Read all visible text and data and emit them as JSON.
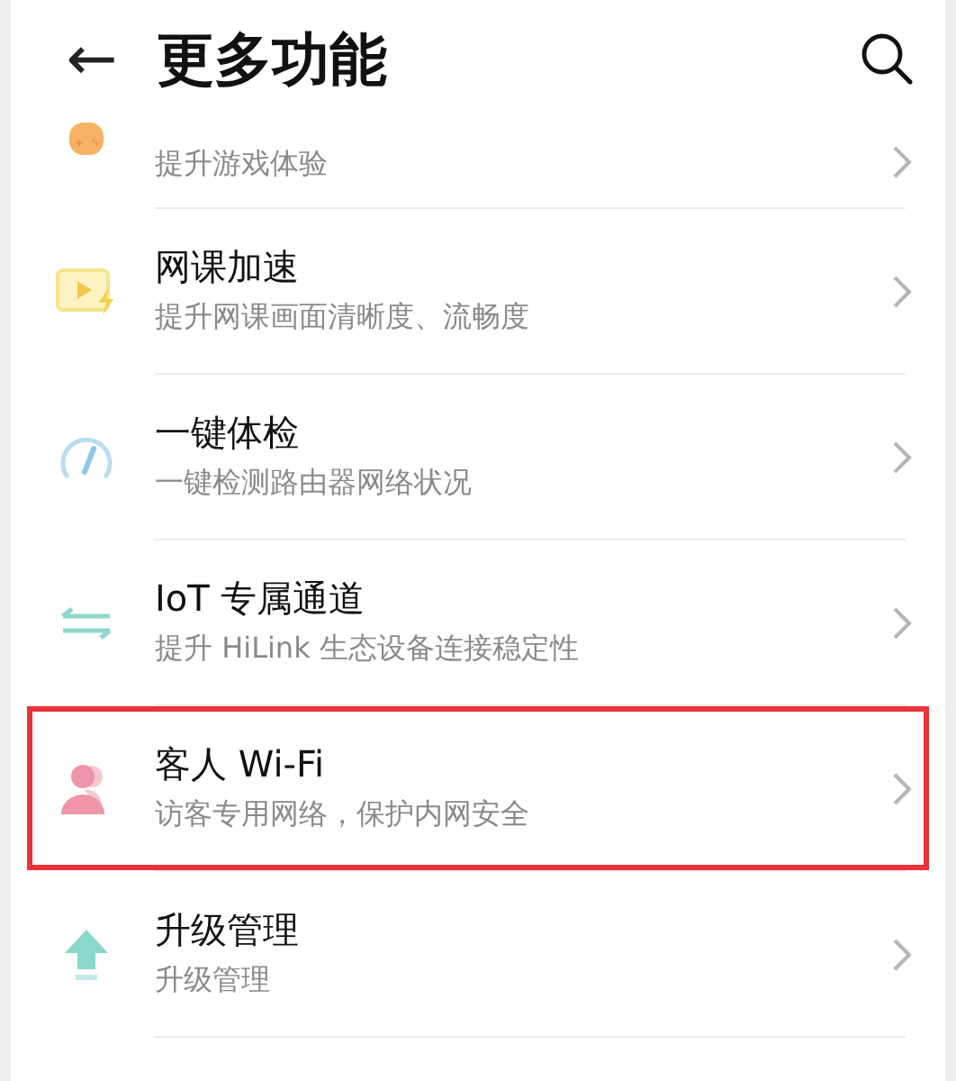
{
  "header": {
    "back": "←",
    "title": "更多功能"
  },
  "items": [
    {
      "subtitle": "提升游戏体验",
      "highlighted": false
    },
    {
      "title": "网课加速",
      "subtitle": "提升网课画面清晰度、流畅度",
      "highlighted": false
    },
    {
      "title": "一键体检",
      "subtitle": "一键检测路由器网络状况",
      "highlighted": false
    },
    {
      "title": "IoT 专属通道",
      "subtitle": "提升 HiLink 生态设备连接稳定性",
      "highlighted": false
    },
    {
      "title": "客人 Wi-Fi",
      "subtitle": "访客专用网络，保护内网安全",
      "highlighted": true
    },
    {
      "title": "升级管理",
      "subtitle": "升级管理",
      "highlighted": false
    }
  ]
}
